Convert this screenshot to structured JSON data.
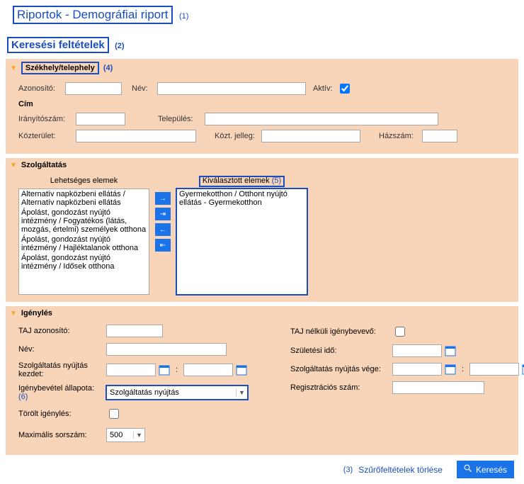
{
  "page": {
    "title": "Riportok - Demográfiai riport"
  },
  "section": {
    "title": "Keresési feltételek"
  },
  "acc1": {
    "head": "Székhely/telephely",
    "id_lbl": "Azonosító:",
    "name_lbl": "Név:",
    "active_lbl": "Aktív:",
    "cim": "Cím",
    "zip_lbl": "Irányítószám:",
    "city_lbl": "Település:",
    "street_lbl": "Közterület:",
    "stype_lbl": "Közt. jelleg:",
    "hnum_lbl": "Házszám:"
  },
  "acc2": {
    "head": "Szolgáltatás",
    "left_title": "Lehetséges elemek",
    "right_title": "Kiválasztott elemek",
    "left_items": [
      "Alternatív napközbeni ellátás / Alternatív napközbeni ellátás",
      "Ápolást, gondozást nyújtó intézmény / Fogyatékos (látás, mozgás, értelmi) személyek otthona",
      "Ápolást, gondozást nyújtó intézmény / Hajléktalanok otthona",
      "Ápolást, gondozást nyújtó intézmény / Idősek otthona"
    ],
    "right_items": [
      "Gyermekotthon / Otthont nyújtó ellátás - Gyermekotthon"
    ]
  },
  "acc3": {
    "head": "Igénylés",
    "taj_lbl": "TAJ azonosító:",
    "name_lbl": "Név:",
    "svc_start_lbl": "Szolgáltatás nyújtás kezdet:",
    "status_lbl": "Igénybevétel állapota:",
    "status_val": "Szolgáltatás nyújtás",
    "deleted_lbl": "Törölt igénylés:",
    "notaj_lbl": "TAJ nélküli igénybevevő:",
    "birth_lbl": "Születési idő:",
    "svc_end_lbl": "Szolgáltatás nyújtás vége:",
    "reg_lbl": "Regisztrációs szám:",
    "max_lbl": "Maximális sorszám:",
    "max_val": "500"
  },
  "footer": {
    "clear": "Szűrőfeltételek törlése",
    "search": "Keresés"
  },
  "annot": {
    "a1": "(1)",
    "a2": "(2)",
    "a3": "(3)",
    "a4": "(4)",
    "a5": "(5)",
    "a6": "(6)"
  }
}
